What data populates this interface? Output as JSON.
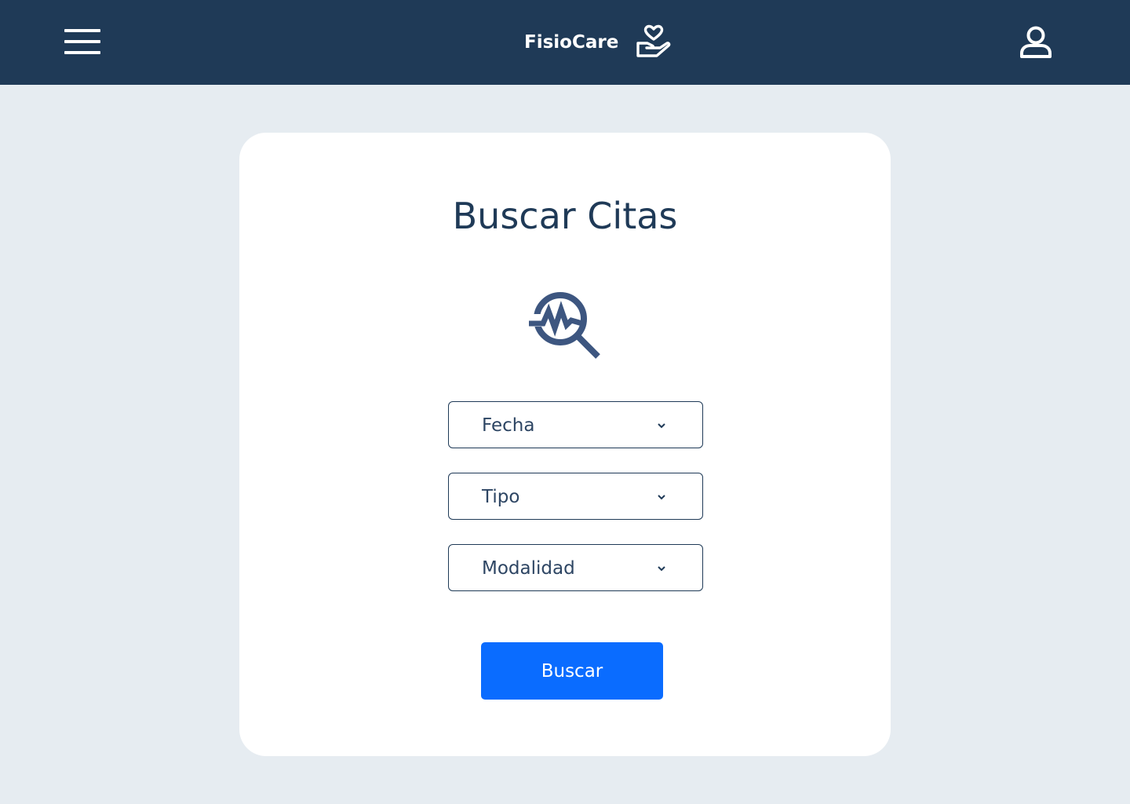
{
  "header": {
    "brand_name": "FisioCare",
    "background_color": "#1f3a57",
    "menu_icon": "hamburger-menu-icon",
    "logo_icon": "heart-hand-logo-icon",
    "user_icon": "user-profile-icon"
  },
  "main": {
    "title": "Buscar Citas",
    "illustration_icon": "magnifier-heartbeat-icon",
    "filters": [
      {
        "label": "Fecha",
        "icon": "chevron-down-icon"
      },
      {
        "label": "Tipo",
        "icon": "chevron-down-icon"
      },
      {
        "label": "Modalidad",
        "icon": "chevron-down-icon"
      }
    ],
    "search_button_label": "Buscar",
    "accent_color": "#0a6cff"
  }
}
